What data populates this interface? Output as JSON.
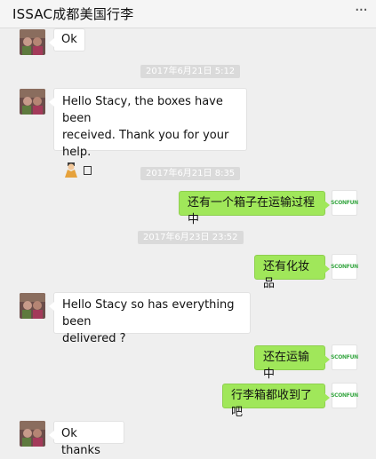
{
  "window": {
    "title": "ISSAC成都美国行李",
    "more_icon": "more-dots-icon"
  },
  "messages": [
    {
      "side": "left",
      "text": "Ok"
    },
    {
      "timestamp": "2017年6月21日 5:12"
    },
    {
      "side": "left",
      "text_lines": [
        "Hello Stacy, the boxes have been",
        "received. Thank you for your help."
      ],
      "emoji": "pray-emoji",
      "trailing_glyph": "unknown-char-box"
    },
    {
      "timestamp": "2017年6月21日 8:35"
    },
    {
      "side": "right",
      "text": "还有一个箱子在运输过程中"
    },
    {
      "timestamp": "2017年6月23日 23:52"
    },
    {
      "side": "right",
      "text": "还有化妆品"
    },
    {
      "side": "left",
      "text_lines": [
        "Hello Stacy so has everything been",
        "delivered ?"
      ]
    },
    {
      "side": "right",
      "text": "还在运输中"
    },
    {
      "side": "right",
      "text": "行李箱都收到了吧"
    },
    {
      "side": "left",
      "text": "Ok thanks"
    }
  ],
  "self_avatar_label": "SCONFUN",
  "colors": {
    "background": "#efefef",
    "bubble_self": "#a0e75a",
    "bubble_other": "#ffffff",
    "timestamp_bg": "#dadada",
    "brand_green": "#3aa845"
  }
}
